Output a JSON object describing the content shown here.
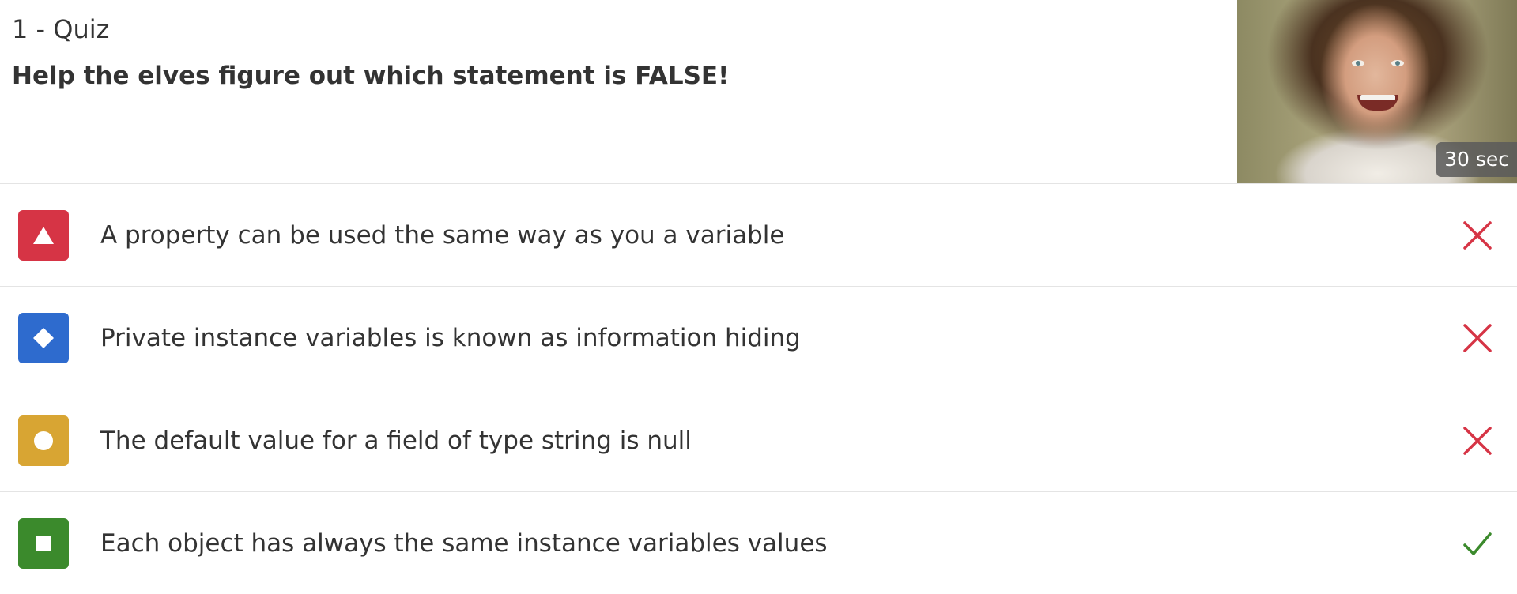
{
  "header": {
    "quiz_label": "1 - Quiz",
    "question": "Help the elves figure out which statement is FALSE!",
    "timer": "30 sec"
  },
  "answers": [
    {
      "text": "A property can be used the same way as you a variable",
      "shape": "triangle-icon",
      "color": "#d63445",
      "correct": false
    },
    {
      "text": "Private instance variables is known as information hiding",
      "shape": "diamond-icon",
      "color": "#2e6bce",
      "correct": false
    },
    {
      "text": "The default value for a field of type string is null",
      "shape": "circle-icon",
      "color": "#d8a533",
      "correct": false
    },
    {
      "text": "Each object has always the same instance variables values",
      "shape": "square-icon",
      "color": "#3b8a2c",
      "correct": true
    }
  ],
  "colors": {
    "incorrect_mark": "#d63445",
    "correct_mark": "#3b8a2c"
  }
}
